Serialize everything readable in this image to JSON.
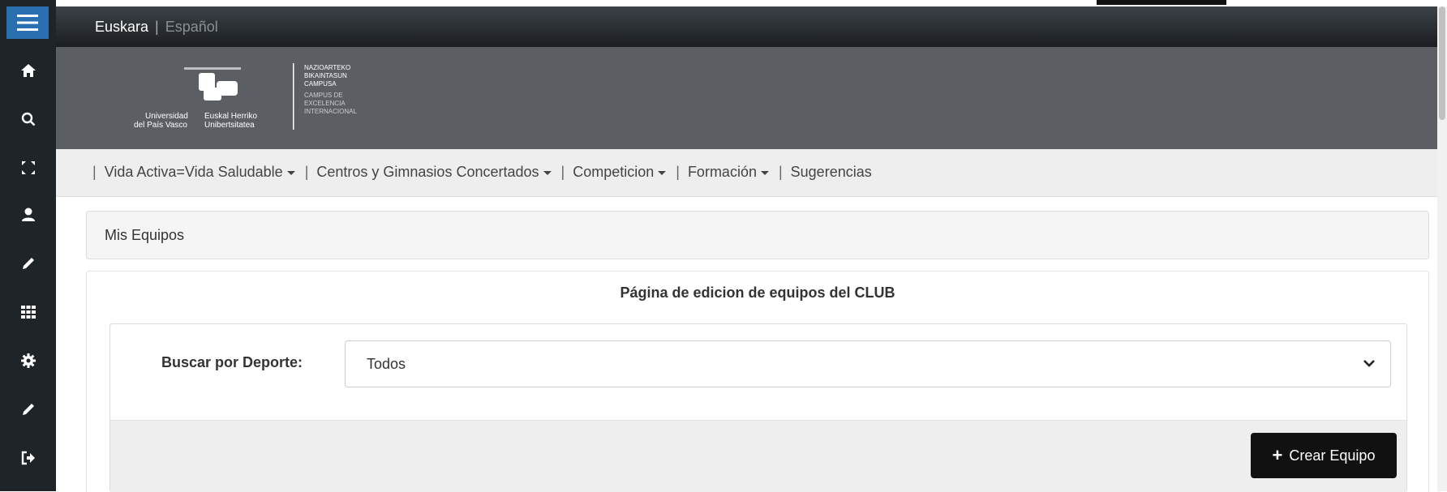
{
  "language_bar": {
    "current": "Euskara",
    "separator": "|",
    "other": "Español"
  },
  "logo": {
    "line1_left": "Universidad",
    "line2_left": "del País Vasco",
    "line1_right": "Euskal Herriko",
    "line2_right": "Unibertsitatea",
    "campus": [
      "NAZIOARTEKO",
      "BIKAINTASUN",
      "CAMPUSA",
      "CAMPUS DE",
      "EXCELENCIA",
      "INTERNACIONAL"
    ]
  },
  "sidebar": {
    "icons": [
      "menu-icon",
      "home-icon",
      "search-icon",
      "expand-icon",
      "user-icon",
      "pencil-icon",
      "grid-icon",
      "gear-icon",
      "pencil-icon",
      "logout-icon"
    ]
  },
  "nav": {
    "items": [
      {
        "label": "Vida Activa=Vida Saludable",
        "dropdown": true
      },
      {
        "label": "Centros y Gimnasios Concertados",
        "dropdown": true
      },
      {
        "label": "Competicion",
        "dropdown": true
      },
      {
        "label": "Formación",
        "dropdown": true
      },
      {
        "label": "Sugerencias",
        "dropdown": false
      }
    ],
    "separator": "|"
  },
  "panel": {
    "heading": "Mis Equipos"
  },
  "card": {
    "title": "Página de edicion de equipos del CLUB",
    "search_label": "Buscar por Deporte:",
    "select_value": "Todos",
    "create_button": "Crear Equipo",
    "create_icon": "plus-icon"
  },
  "colors": {
    "sidebar_bg": "#1f2429",
    "menu_accent": "#2a6fb0",
    "logo_band": "#5b5f63",
    "nav_bg": "#eeeeee",
    "button_bg": "#111111"
  }
}
